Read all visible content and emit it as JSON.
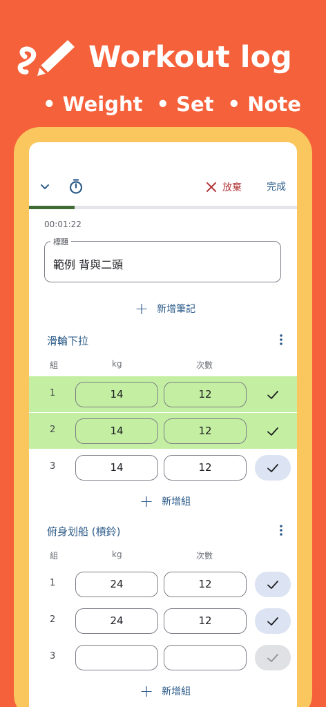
{
  "hero": {
    "title": "Workout log",
    "bullets": [
      "Weight",
      "Set",
      "Note"
    ]
  },
  "colors": {
    "background": "#F5613A",
    "frame": "#F9C75E",
    "accent": "#2E5C8A",
    "discard": "#B3373A",
    "done_row": "#C4EFA2",
    "progress": "#3F6B34"
  },
  "toolbar": {
    "discard_label": "放棄",
    "finish_label": "完成",
    "collapse_icon": "chevron-down-icon",
    "timer_icon": "timer-icon"
  },
  "progress": {
    "fraction": 0.17
  },
  "session": {
    "elapsed": "00:01:22",
    "title_label": "標題",
    "title_value": "範例 背與二頭",
    "add_note_label": "新增筆記"
  },
  "exercises": [
    {
      "name": "滑輪下拉",
      "headers": {
        "set": "組",
        "kg": "kg",
        "reps": "次數"
      },
      "sets": [
        {
          "num": "1",
          "kg": "14",
          "reps": "12",
          "done": true
        },
        {
          "num": "2",
          "kg": "14",
          "reps": "12",
          "done": true
        },
        {
          "num": "3",
          "kg": "14",
          "reps": "12",
          "done": false
        }
      ],
      "add_set_label": "新增組"
    },
    {
      "name": "俯身划船 (槓鈴)",
      "headers": {
        "set": "組",
        "kg": "kg",
        "reps": "次數"
      },
      "sets": [
        {
          "num": "1",
          "kg": "24",
          "reps": "12",
          "done": false
        },
        {
          "num": "2",
          "kg": "24",
          "reps": "12",
          "done": false
        },
        {
          "num": "3",
          "kg": "",
          "reps": "",
          "done": false
        }
      ],
      "add_set_label": "新增組"
    }
  ]
}
